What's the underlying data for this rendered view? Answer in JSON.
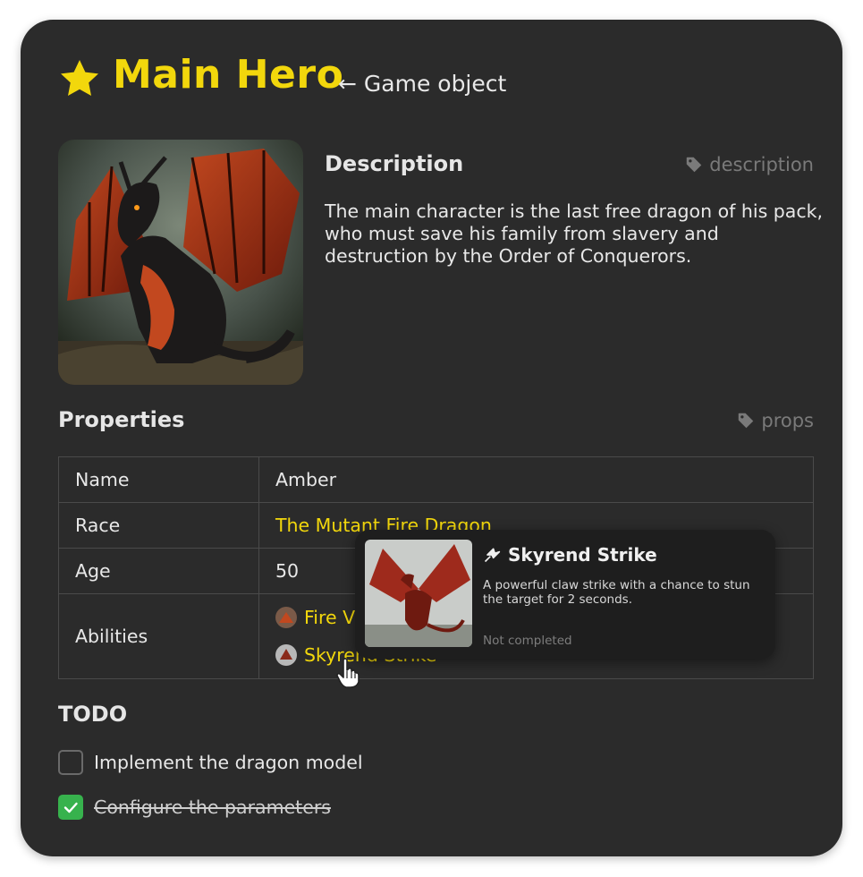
{
  "header": {
    "icon": "star-icon",
    "title": "Main Hero",
    "subtitle": "← Game object"
  },
  "description": {
    "heading": "Description",
    "tag": "description",
    "text": "The main character is the last free dragon of his pack, who must save his family from slavery and destruction by the Order of Conquerors."
  },
  "properties": {
    "heading": "Properties",
    "tag": "props",
    "rows": [
      {
        "key": "Name",
        "value": "Amber"
      },
      {
        "key": "Race",
        "value": "The Mutant Fire Dragon"
      },
      {
        "key": "Age",
        "value": "50"
      },
      {
        "key": "Abilities",
        "abilities": [
          "Fire V",
          "Skyrend Strike"
        ]
      }
    ]
  },
  "tooltip": {
    "title": "Skyrend Strike",
    "description": "A powerful claw strike with a chance to stun the target for 2 seconds.",
    "status": "Not completed"
  },
  "todo": {
    "heading": "TODO",
    "items": [
      {
        "label": "Implement the dragon model",
        "checked": false
      },
      {
        "label": "Configure the parameters",
        "checked": true
      }
    ]
  },
  "colors": {
    "card_bg": "#2b2b2b",
    "accent": "#f2d70c",
    "check": "#37b24d"
  }
}
